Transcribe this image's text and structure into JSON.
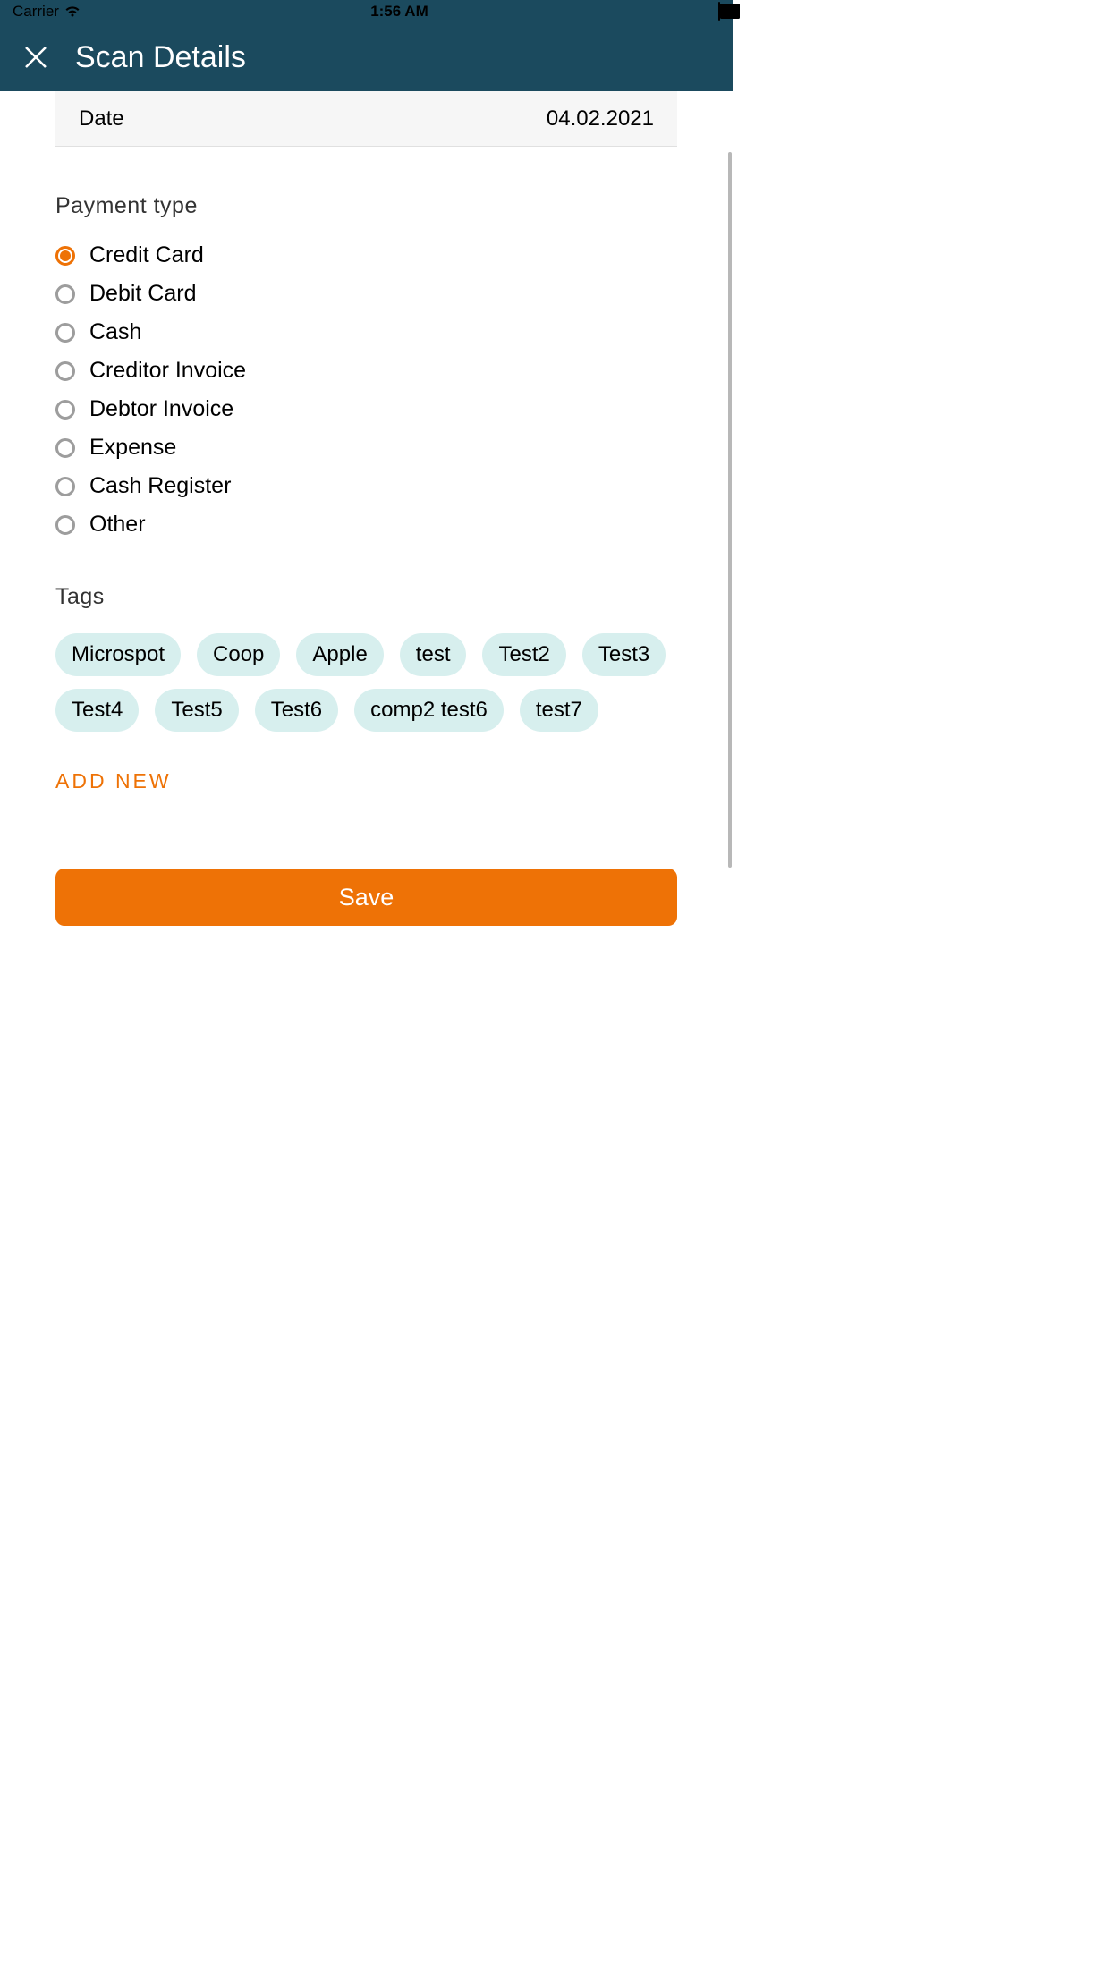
{
  "status_bar": {
    "carrier": "Carrier",
    "time": "1:56 AM"
  },
  "header": {
    "title": "Scan Details"
  },
  "date": {
    "label": "Date",
    "value": "04.02.2021"
  },
  "payment_type": {
    "header": "Payment type",
    "options": [
      {
        "label": "Credit Card",
        "selected": true
      },
      {
        "label": "Debit Card",
        "selected": false
      },
      {
        "label": "Cash",
        "selected": false
      },
      {
        "label": "Creditor Invoice",
        "selected": false
      },
      {
        "label": "Debtor Invoice",
        "selected": false
      },
      {
        "label": "Expense",
        "selected": false
      },
      {
        "label": "Cash Register",
        "selected": false
      },
      {
        "label": "Other",
        "selected": false
      }
    ]
  },
  "tags": {
    "header": "Tags",
    "items": [
      "Microspot",
      "Coop",
      "Apple",
      "test",
      "Test2",
      "Test3",
      "Test4",
      "Test5",
      "Test6",
      "comp2 test6",
      "test7"
    ],
    "add_new_label": "ADD NEW"
  },
  "save_button": "Save",
  "colors": {
    "accent": "#ee7206",
    "header_bg": "#1b4a5e",
    "tag_bg": "#d7efee"
  }
}
